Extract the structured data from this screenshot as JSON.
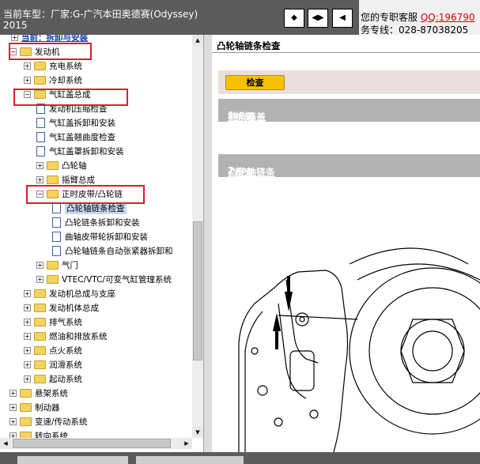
{
  "header": {
    "car_model_line1": "当前车型：厂家:G-广汽本田奥德赛(Odyssey)",
    "car_model_line2": "2015",
    "nav_buttons": [
      {
        "icon": "sync-toc-icon",
        "glyph": "◆"
      },
      {
        "icon": "prev-next-icon",
        "glyph": "◀▶"
      },
      {
        "icon": "next-icon",
        "glyph": "◀"
      }
    ],
    "service_label": "您的专职客服",
    "qq_label": "QQ:196790",
    "hotline": "务专线：028-87038205"
  },
  "tree": {
    "first_item": "当前：拆卸与安装",
    "items": [
      {
        "label": "发动机",
        "level": 0,
        "kind": "folder",
        "expander": "−"
      },
      {
        "label": "充电系统",
        "level": 1,
        "kind": "folder",
        "expander": "+"
      },
      {
        "label": "冷却系统",
        "level": 1,
        "kind": "folder",
        "expander": "+"
      },
      {
        "label": "气缸盖总成",
        "level": 1,
        "kind": "folder",
        "expander": "−"
      },
      {
        "label": "发动机压缩检查",
        "level": 2,
        "kind": "doc"
      },
      {
        "label": "气缸盖拆卸和安装",
        "level": 2,
        "kind": "doc"
      },
      {
        "label": "气缸盖翘曲度检查",
        "level": 2,
        "kind": "doc"
      },
      {
        "label": "气缸盖罩拆卸和安装",
        "level": 2,
        "kind": "doc"
      },
      {
        "label": "凸轮轴",
        "level": 2,
        "kind": "folder",
        "expander": "+"
      },
      {
        "label": "摇臂总成",
        "level": 2,
        "kind": "folder",
        "expander": "+"
      },
      {
        "label": "正时皮带/凸轮链",
        "level": 2,
        "kind": "folder",
        "expander": "−"
      },
      {
        "label": "凸轮轴链条检查",
        "level": 3,
        "kind": "doc",
        "selected": true
      },
      {
        "label": "凸轮链条拆卸和安装",
        "level": 3,
        "kind": "doc"
      },
      {
        "label": "曲轴皮带轮拆卸和安装",
        "level": 3,
        "kind": "doc"
      },
      {
        "label": "凸轮轴链条自动张紧器拆卸和",
        "level": 3,
        "kind": "doc"
      },
      {
        "label": "气门",
        "level": 2,
        "kind": "folder",
        "expander": "+"
      },
      {
        "label": "VTEC/VTC/可变气缸管理系统",
        "level": 2,
        "kind": "folder",
        "expander": "+"
      },
      {
        "label": "发动机总成与支座",
        "level": 1,
        "kind": "folder",
        "expander": "+"
      },
      {
        "label": "发动机体总成",
        "level": 1,
        "kind": "folder",
        "expander": "+"
      },
      {
        "label": "排气系统",
        "level": 1,
        "kind": "folder",
        "expander": "+"
      },
      {
        "label": "燃油和排放系统",
        "level": 1,
        "kind": "folder",
        "expander": "+"
      },
      {
        "label": "点火系统",
        "level": 1,
        "kind": "folder",
        "expander": "+"
      },
      {
        "label": "润滑系统",
        "level": 1,
        "kind": "folder",
        "expander": "+"
      },
      {
        "label": "起动系统",
        "level": 1,
        "kind": "folder",
        "expander": "+"
      },
      {
        "label": "悬架系统",
        "level": 0,
        "kind": "folder",
        "expander": "+"
      },
      {
        "label": "制动器",
        "level": 0,
        "kind": "folder",
        "expander": "+"
      },
      {
        "label": "变速/传动系统",
        "level": 0,
        "kind": "folder",
        "expander": "+"
      },
      {
        "label": "转向系统",
        "level": 0,
        "kind": "folder",
        "expander": "+"
      }
    ]
  },
  "content": {
    "title": "凸轮轴链条检查",
    "check_button": "检查",
    "sections": [
      {
        "num": "1.",
        "link": "链条箱盖",
        "suffix": "- 拆卸"
      },
      {
        "num": "2.",
        "link": "凸轮轴链条",
        "suffix": "- 检查"
      }
    ]
  },
  "colors": {
    "header_bg": "#5b5b5b",
    "highlight_box": "#e11b2c",
    "qq": "#e00000",
    "button": "#f5c200",
    "section_bar": "#b2b2b2"
  }
}
